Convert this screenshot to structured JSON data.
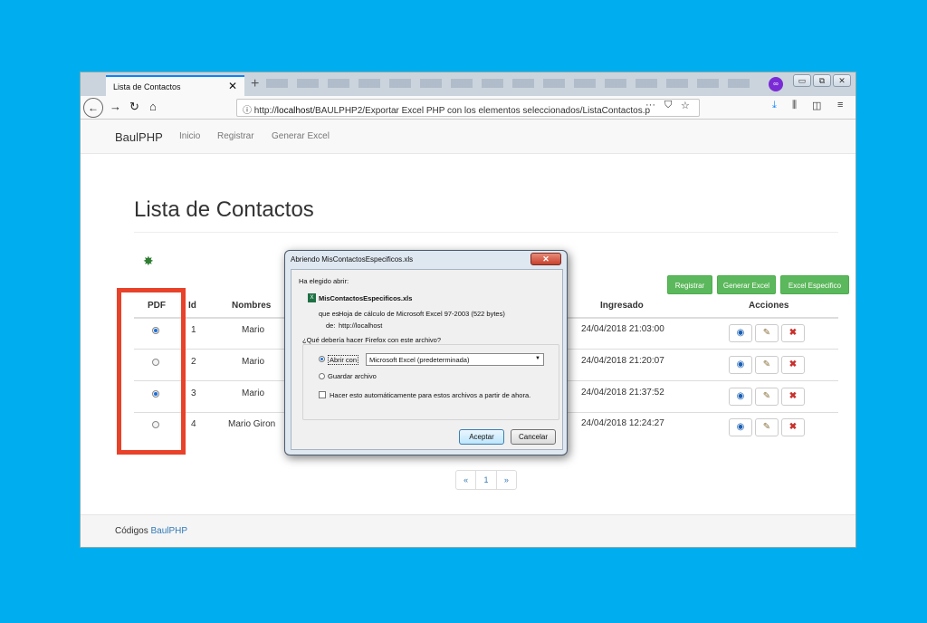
{
  "browser": {
    "tab_title": "Lista de Contactos",
    "tab_close": "✕",
    "new_tab": "+",
    "url_prefix": "http://",
    "url_host": "localhost",
    "url_path": "/BAULPHP2/Exportar Excel PHP con los elementos seleccionados/ListaContactos.p",
    "url_more": "···",
    "private_icon": "∞",
    "win_minimize": "▭",
    "win_restore": "⧉",
    "win_close": "✕"
  },
  "site": {
    "brand": "BaulPHP",
    "nav": [
      "Inicio",
      "Registrar",
      "Generar Excel"
    ],
    "page_title": "Lista de Contactos",
    "buttons": {
      "registrar": "Registrar",
      "generar_excel": "Generar Excel",
      "excel_especifico": "Excel Especifico"
    },
    "table": {
      "headers": {
        "pdf": "PDF",
        "id": "Id",
        "nombres": "Nombres",
        "ingresado": "Ingresado",
        "acciones": "Acciones"
      },
      "rows": [
        {
          "checked": true,
          "id": "1",
          "nombre": "Mario",
          "ingresado": "24/04/2018 21:03:00"
        },
        {
          "checked": false,
          "id": "2",
          "nombre": "Mario",
          "ingresado": "24/04/2018 21:20:07"
        },
        {
          "checked": true,
          "id": "3",
          "nombre": "Mario",
          "ingresado": "24/04/2018 21:37:52"
        },
        {
          "checked": false,
          "id": "4",
          "nombre": "Mario Giron",
          "ingresado": "24/04/2018 12:24:27"
        }
      ]
    },
    "pager": [
      "«",
      "1",
      "»"
    ],
    "footer_text": "Códigos ",
    "footer_link": "BaulPHP"
  },
  "dialog": {
    "title": "Abriendo MisContactosEspecificos.xls",
    "close": "✕",
    "intro": "Ha elegido abrir:",
    "filename": "MisContactosEspecificos.xls",
    "type_label": "que es:",
    "type_value": "Hoja de cálculo de Microsoft Excel 97-2003 (522 bytes)",
    "from_label": "de:",
    "from_value": "http://localhost",
    "question": "¿Qué debería hacer Firefox con este archivo?",
    "open_with": "Abrir con",
    "open_with_app": "Microsoft Excel (predeterminada)",
    "save_file": "Guardar archivo",
    "auto_action": "Hacer esto automáticamente para estos archivos a partir de ahora.",
    "accept": "Aceptar",
    "cancel": "Cancelar"
  },
  "colors": {
    "background": "#00adee",
    "btn_green": "#5cb85c",
    "highlight_box": "#e8422a",
    "link": "#337ab7"
  }
}
